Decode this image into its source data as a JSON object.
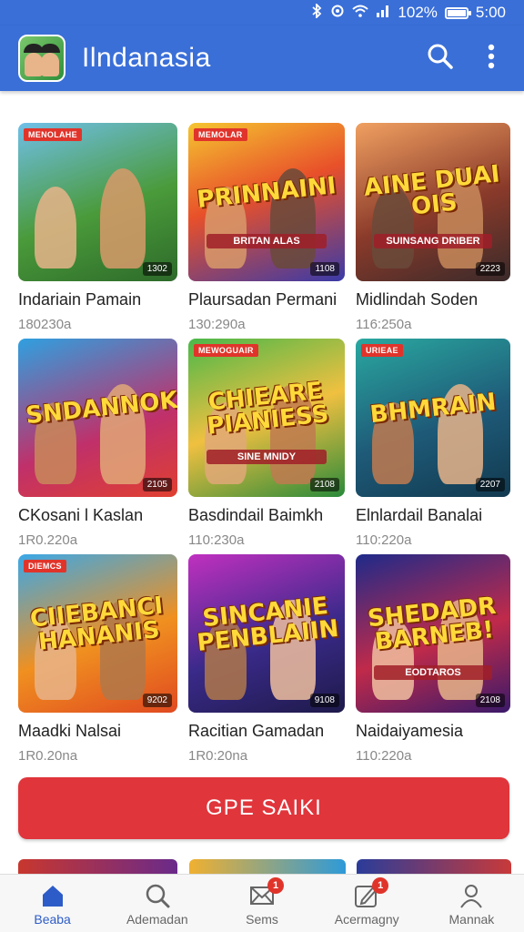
{
  "status_bar": {
    "battery_text": "102%",
    "battery_level": 1.0,
    "time": "5:00",
    "icons": [
      "bluetooth-icon",
      "sync-icon",
      "wifi-icon",
      "signal-icon",
      "battery-icon"
    ]
  },
  "app_bar": {
    "title": "Ilndanasia",
    "actions": [
      "search-icon",
      "more-vert-icon"
    ]
  },
  "colors": {
    "primary": "#3a6fd8",
    "cta": "#e0353b",
    "badge": "#e0342b",
    "nav_active": "#2d5cc8"
  },
  "games": [
    {
      "title": "Indariain Pamain",
      "meta": "180230a",
      "tag": "MENOLAHE",
      "count": "1302",
      "headline": "",
      "subline": ""
    },
    {
      "title": "Plaursadan Permani",
      "meta": "130:290a",
      "tag": "MEMOLAR",
      "count": "1108",
      "headline": "PRINNAINI",
      "subline": "BRITAN ALAS"
    },
    {
      "title": "Midlindah Soden",
      "meta": "116:250a",
      "tag": "",
      "count": "2223",
      "headline": "AINE DUAI OIS",
      "subline": "SUINSANG DRIBER"
    },
    {
      "title": "CKosani l Kaslan",
      "meta": "1R0.220a",
      "tag": "",
      "count": "2105",
      "headline": "SNDANNOK",
      "subline": ""
    },
    {
      "title": "Basdindail Baimkh",
      "meta": "110:230a",
      "tag": "MEWOGUAIR",
      "count": "2108",
      "headline": "CHIEARE PIANIESS",
      "subline": "SINE MNIDY"
    },
    {
      "title": "Elnlardail Banalai",
      "meta": "110:220a",
      "tag": "URIEAE",
      "count": "2207",
      "headline": "BHMRAIN",
      "subline": ""
    },
    {
      "title": "Maadki Nalsai",
      "meta": "1R0.20na",
      "tag": "DIEMCS",
      "count": "9202",
      "headline": "CIIEBANCI HANANIS",
      "subline": ""
    },
    {
      "title": "Racitian Gamadan",
      "meta": "1R0:20na",
      "tag": "",
      "count": "9108",
      "headline": "SINCANIE PENBLAIIN",
      "subline": ""
    },
    {
      "title": "Naidaiyamesia",
      "meta": "110:220a",
      "tag": "",
      "count": "2108",
      "headline": "SHEDADR BARNEB!",
      "subline": "EODTAROS"
    }
  ],
  "cta": {
    "label": "GPE SAIKI"
  },
  "bottom_nav": [
    {
      "label": "Beaba",
      "icon": "home-icon",
      "active": true,
      "badge": ""
    },
    {
      "label": "Ademadan",
      "icon": "search-icon",
      "active": false,
      "badge": ""
    },
    {
      "label": "Sems",
      "icon": "mail-icon",
      "active": false,
      "badge": "1"
    },
    {
      "label": "Acermagny",
      "icon": "edit-icon",
      "active": false,
      "badge": "1"
    },
    {
      "label": "Mannak",
      "icon": "profile-icon",
      "active": false,
      "badge": ""
    }
  ]
}
